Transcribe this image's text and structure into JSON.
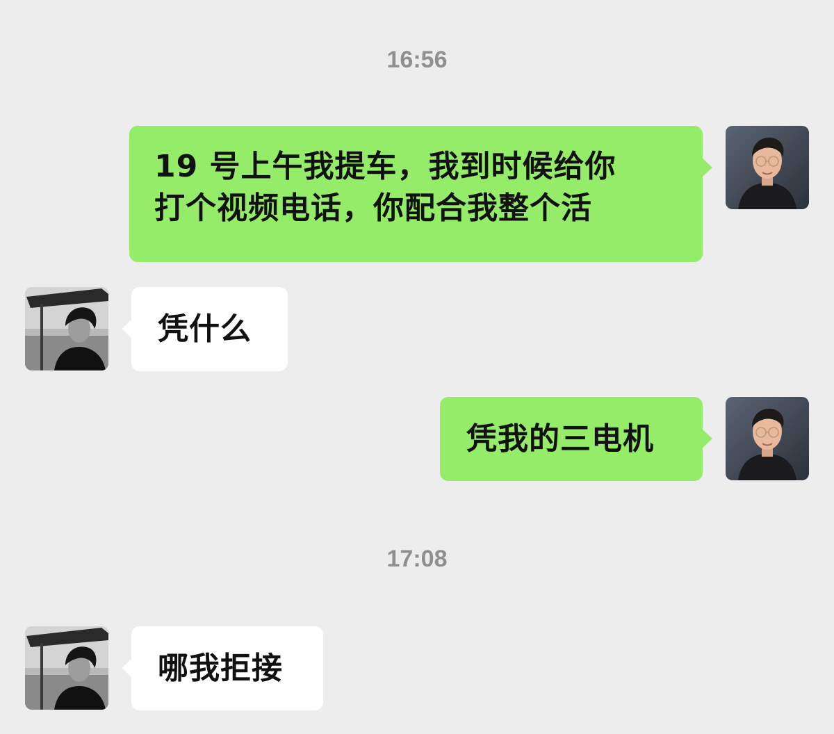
{
  "chat": {
    "timestamps": [
      "16:56",
      "17:08"
    ],
    "messages": [
      {
        "side": "sent",
        "lines": [
          "19 号上午我提车，我到时候给你",
          "打个视频电话，你配合我整个活"
        ]
      },
      {
        "side": "received",
        "text": "凭什么"
      },
      {
        "side": "sent",
        "text": "凭我的三电机"
      },
      {
        "side": "received",
        "text": "哪我拒接"
      }
    ]
  },
  "colors": {
    "background": "#ededed",
    "sent_bubble": "#95ec69",
    "received_bubble": "#ffffff",
    "timestamp_text": "#8f8f8f"
  },
  "icons": {
    "self_avatar": "avatar-photo-man-glasses",
    "contact_avatar": "avatar-photo-grayscale-person"
  }
}
